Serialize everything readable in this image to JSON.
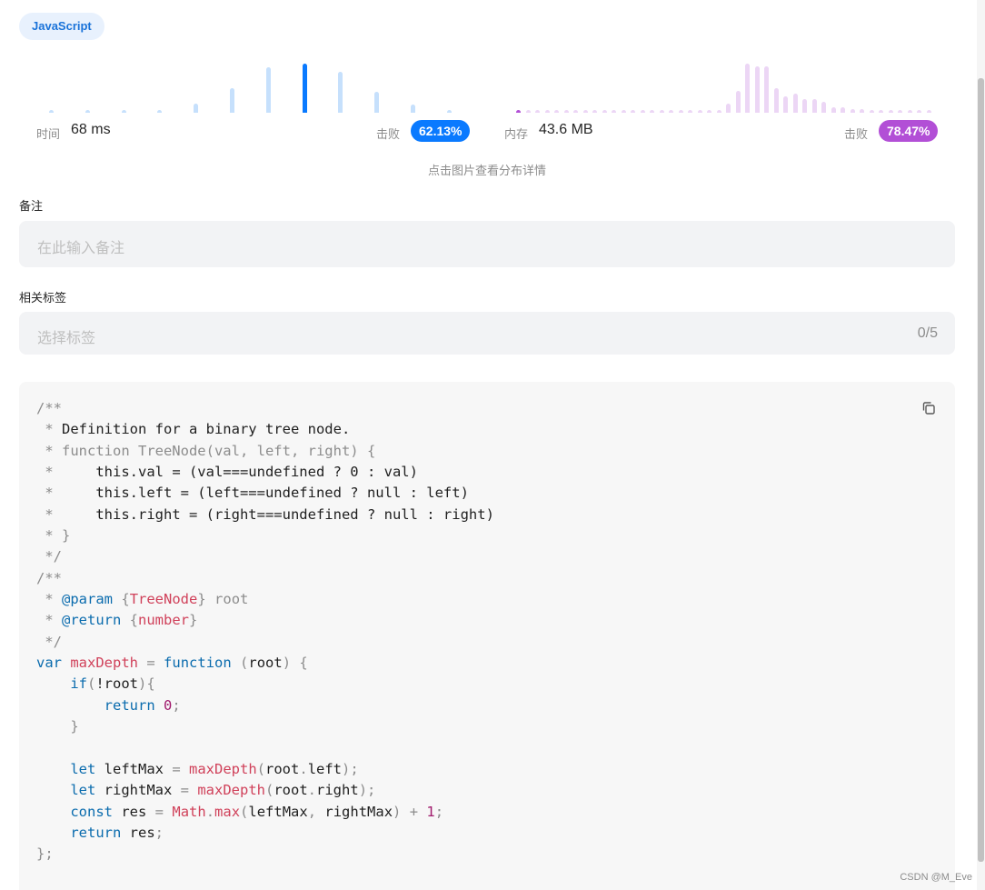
{
  "language_tag": "JavaScript",
  "runtime": {
    "label": "时间",
    "value": "68 ms",
    "beat_label": "击败",
    "beat_percent": "62.13%",
    "color": "#0a7aff",
    "bar_levels": [
      0.04,
      0.04,
      0.04,
      0.04,
      0.19,
      0.5,
      0.92,
      1.0,
      0.83,
      0.42,
      0.17,
      0.06
    ],
    "highlight_index": 7
  },
  "memory": {
    "label": "内存",
    "value": "43.6 MB",
    "beat_label": "击败",
    "beat_percent": "78.47%",
    "color": "#b24fd6",
    "bar_levels": [
      0.06,
      0.04,
      0.04,
      0.04,
      0.04,
      0.04,
      0.04,
      0.04,
      0.04,
      0.04,
      0.04,
      0.04,
      0.04,
      0.04,
      0.04,
      0.04,
      0.04,
      0.04,
      0.04,
      0.04,
      0.04,
      0.04,
      0.19,
      0.44,
      1.0,
      0.94,
      0.94,
      0.5,
      0.33,
      0.39,
      0.28,
      0.28,
      0.22,
      0.11,
      0.11,
      0.08,
      0.08,
      0.06,
      0.06,
      0.06,
      0.06,
      0.06,
      0.06,
      0.06
    ],
    "highlight_index": 0
  },
  "distribution_hint": "点击图片查看分布详情",
  "note": {
    "label": "备注",
    "placeholder": "在此输入备注"
  },
  "tags": {
    "label": "相关标签",
    "placeholder": "选择标签",
    "count": "0/5"
  },
  "code": {
    "copy_icon": "copy-icon",
    "language": "javascript"
  },
  "watermark": "CSDN @M_Eve"
}
